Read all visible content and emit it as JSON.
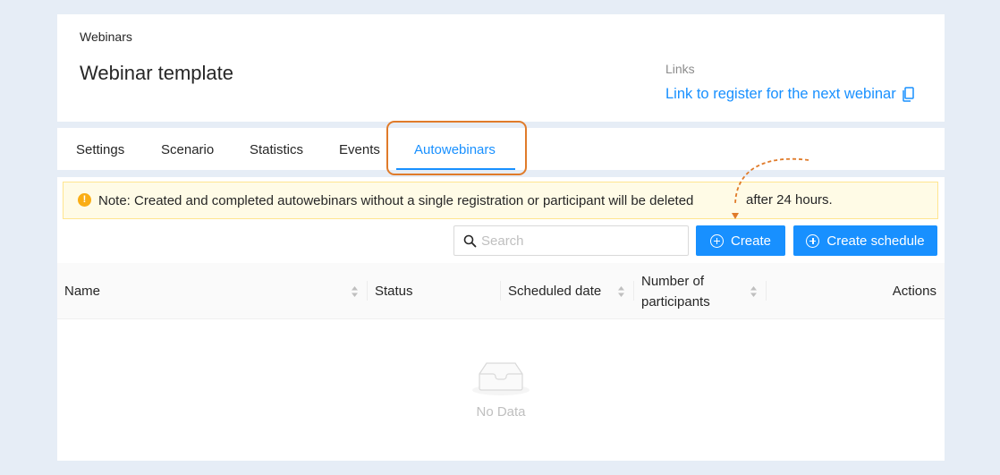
{
  "header": {
    "breadcrumb": "Webinars",
    "title": "Webinar template",
    "links_label": "Links",
    "register_link": "Link to register for the next webinar"
  },
  "tabs": [
    {
      "label": "Settings",
      "active": false
    },
    {
      "label": "Scenario",
      "active": false
    },
    {
      "label": "Statistics",
      "active": false
    },
    {
      "label": "Events",
      "active": false
    },
    {
      "label": "Autowebinars",
      "active": true
    }
  ],
  "notice": {
    "text": "Note: Created and completed autowebinars without a single registration or participant will be deleted",
    "extra": "after 24 hours.",
    "icon": "exclamation-circle-icon"
  },
  "toolbar": {
    "search_placeholder": "Search",
    "create_label": "Create",
    "create_schedule_label": "Create schedule"
  },
  "table": {
    "columns": [
      {
        "label": "Name",
        "sortable": true
      },
      {
        "label": "Status",
        "sortable": false
      },
      {
        "label": "Scheduled date",
        "sortable": true
      },
      {
        "label": "Number of participants",
        "sortable": true
      },
      {
        "label": "Actions",
        "sortable": false
      }
    ],
    "rows": [],
    "empty_text": "No Data"
  },
  "colors": {
    "background": "#e6edf6",
    "primary": "#1890ff",
    "highlight": "#e07b2a",
    "warning": "#faad14"
  }
}
